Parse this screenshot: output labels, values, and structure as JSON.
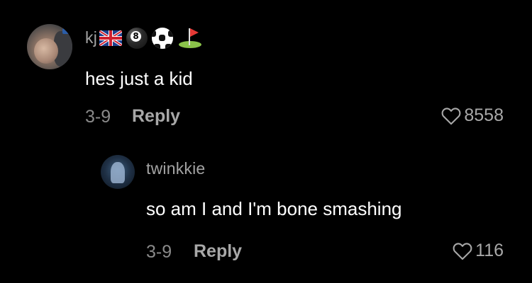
{
  "comments": [
    {
      "username": "kj",
      "badges": [
        "uk-flag",
        "8-ball",
        "soccer-ball",
        "golf-flag"
      ],
      "text": "hes just a kid",
      "date": "3-9",
      "reply_label": "Reply",
      "likes": "8558"
    },
    {
      "username": "twinkkie",
      "text": "so am I and I'm bone smashing",
      "date": "3-9",
      "reply_label": "Reply",
      "likes": "116"
    }
  ],
  "badge_glyphs": {
    "eightball": "8"
  },
  "colors": {
    "background": "#000000",
    "primary_text": "#ffffff",
    "secondary_text": "#8a8a8a"
  }
}
